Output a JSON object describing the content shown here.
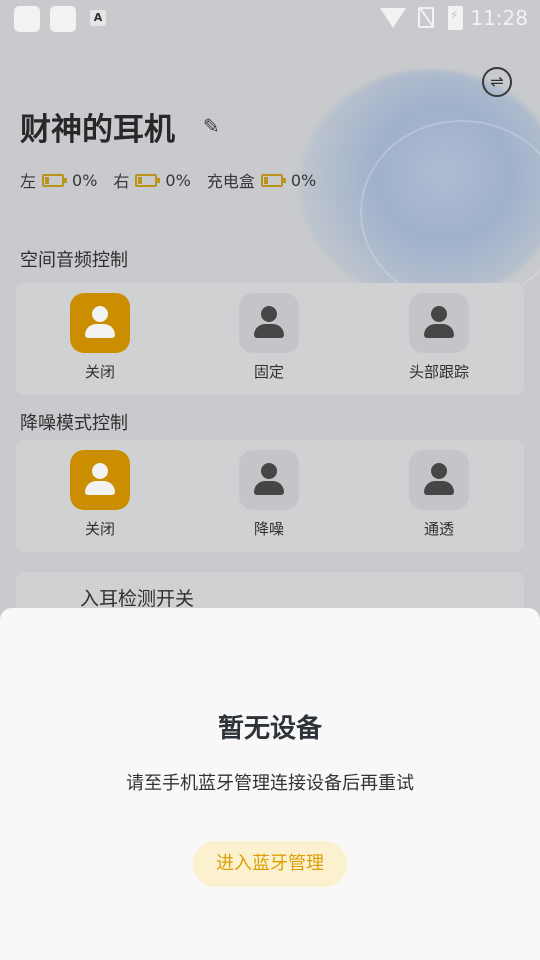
{
  "status_bar": {
    "time": "11:28",
    "a_icon": "A"
  },
  "header": {
    "device_name": "财神的耳机"
  },
  "battery": [
    {
      "label": "左",
      "value": "0%"
    },
    {
      "label": "右",
      "value": "0%"
    },
    {
      "label": "充电盒",
      "value": "0%"
    }
  ],
  "spatial_audio": {
    "title": "空间音频控制",
    "options": [
      {
        "label": "关闭",
        "active": true
      },
      {
        "label": "固定",
        "active": false
      },
      {
        "label": "头部跟踪",
        "active": false
      }
    ]
  },
  "noise_control": {
    "title": "降噪模式控制",
    "options": [
      {
        "label": "关闭",
        "active": true
      },
      {
        "label": "降噪",
        "active": false
      },
      {
        "label": "通透",
        "active": false
      }
    ]
  },
  "ear_detection": {
    "label": "入耳检测开关"
  },
  "sheet": {
    "title": "暂无设备",
    "description": "请至手机蓝牙管理连接设备后再重试",
    "button": "进入蓝牙管理"
  },
  "colors": {
    "accent": "#d69600",
    "button_bg": "#fcf1cf",
    "button_text": "#dba005"
  }
}
